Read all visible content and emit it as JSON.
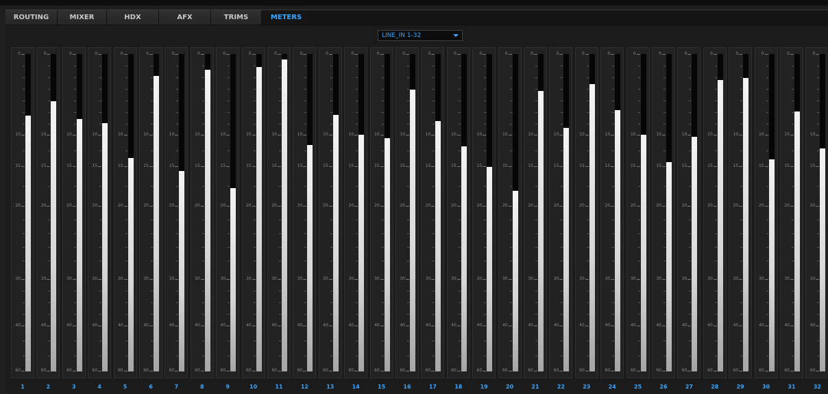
{
  "tabs": [
    {
      "label": "ROUTING",
      "active": false
    },
    {
      "label": "MIXER",
      "active": false
    },
    {
      "label": "HDX",
      "active": false
    },
    {
      "label": "AFX",
      "active": false
    },
    {
      "label": "TRIMS",
      "active": false
    },
    {
      "label": "METERS",
      "active": true
    }
  ],
  "selector": {
    "value": "LINE_IN 1-32"
  },
  "scale_labels": [
    "0",
    "10",
    "15",
    "20",
    "30",
    "40",
    "60"
  ],
  "channels": [
    {
      "label": "1",
      "level": 0.805
    },
    {
      "label": "2",
      "level": 0.852
    },
    {
      "label": "3",
      "level": 0.795
    },
    {
      "label": "4",
      "level": 0.783
    },
    {
      "label": "5",
      "level": 0.672
    },
    {
      "label": "6",
      "level": 0.93
    },
    {
      "label": "7",
      "level": 0.632
    },
    {
      "label": "8",
      "level": 0.951
    },
    {
      "label": "9",
      "level": 0.577
    },
    {
      "label": "10",
      "level": 0.96
    },
    {
      "label": "11",
      "level": 0.983
    },
    {
      "label": "12",
      "level": 0.714
    },
    {
      "label": "13",
      "level": 0.808
    },
    {
      "label": "14",
      "level": 0.745
    },
    {
      "label": "15",
      "level": 0.734
    },
    {
      "label": "16",
      "level": 0.888
    },
    {
      "label": "17",
      "level": 0.788
    },
    {
      "label": "18",
      "level": 0.708
    },
    {
      "label": "19",
      "level": 0.645
    },
    {
      "label": "20",
      "level": 0.57
    },
    {
      "label": "21",
      "level": 0.884
    },
    {
      "label": "22",
      "level": 0.768
    },
    {
      "label": "23",
      "level": 0.906
    },
    {
      "label": "24",
      "level": 0.824
    },
    {
      "label": "25",
      "level": 0.745
    },
    {
      "label": "26",
      "level": 0.66
    },
    {
      "label": "27",
      "level": 0.74
    },
    {
      "label": "28",
      "level": 0.918
    },
    {
      "label": "29",
      "level": 0.925
    },
    {
      "label": "30",
      "level": 0.668
    },
    {
      "label": "31",
      "level": 0.82
    },
    {
      "label": "32",
      "level": 0.702
    }
  ],
  "colors": {
    "accent": "#3aa6ff",
    "background": "#1e1e1e",
    "meter_fill": "#e6e6e6"
  }
}
